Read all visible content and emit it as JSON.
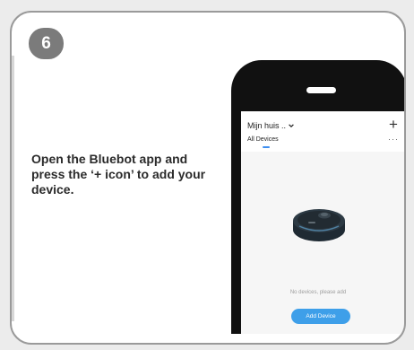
{
  "step": {
    "number": "6"
  },
  "instruction": {
    "line1": "Open the Bluebot app and",
    "line2": "press the ‘+ icon’ to add your",
    "line3": "device."
  },
  "app": {
    "home_name": "Mijn huis ..",
    "add_icon": "+",
    "tab_all": "All Devices",
    "more_icon": "···",
    "empty_message": "No devices, please add",
    "add_device_label": "Add Device",
    "accent_color": "#3e9fe9"
  },
  "icons": [
    "plus-icon",
    "chevron-down-icon",
    "more-icon",
    "robot-vacuum-image"
  ]
}
